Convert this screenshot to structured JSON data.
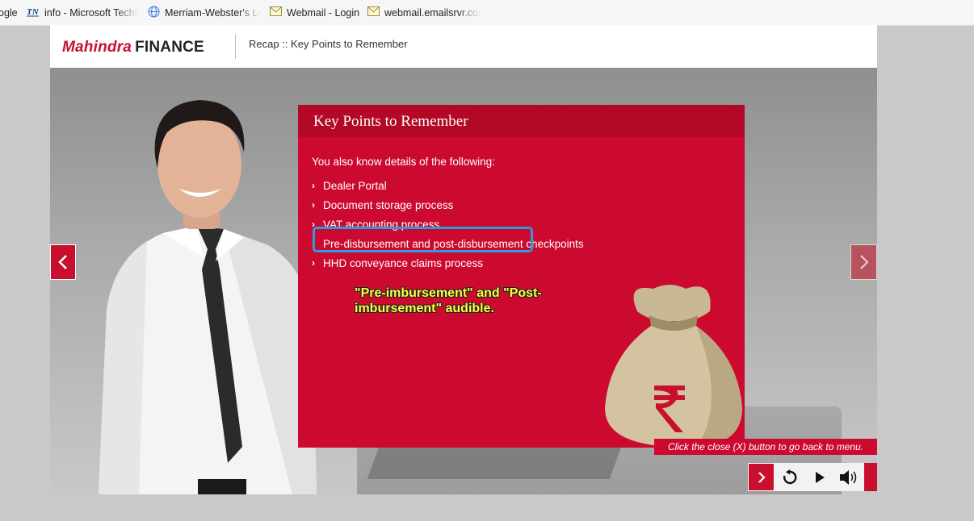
{
  "browser": {
    "bookmarks": [
      {
        "icon": "google-icon",
        "label": "ogle"
      },
      {
        "icon": "tn-icon",
        "label": "info - Microsoft TechN"
      },
      {
        "icon": "globe-icon",
        "label": "Merriam-Webster's Le"
      },
      {
        "icon": "mail-icon",
        "label": "Webmail - Login"
      },
      {
        "icon": "mail-icon",
        "label": "webmail.emailsrvr.com"
      }
    ]
  },
  "header": {
    "logo_brand": "Mahindra",
    "logo_suffix": "FINANCE",
    "title": "Recap :: Key Points to Remember"
  },
  "panel": {
    "title": "Key Points to Remember",
    "intro": "You also know details of the following:",
    "points": [
      "Dealer Portal",
      "Document storage process",
      "VAT accounting process",
      "Pre-disbursement and post-disbursement checkpoints",
      "HHD conveyance claims process"
    ]
  },
  "annotation": {
    "line1": "\"Pre-imbursement\" and \"Post-",
    "line2": "imbursement\"  audible."
  },
  "hint": "Click the close (X) button to go back to menu.",
  "controls": [
    "next-icon",
    "replay-icon",
    "play-icon",
    "volume-icon"
  ],
  "colors": {
    "accent": "#cc0a2f",
    "header_band": "#b30826",
    "highlight": "#2b9ae0",
    "note": "#ffff3c"
  }
}
